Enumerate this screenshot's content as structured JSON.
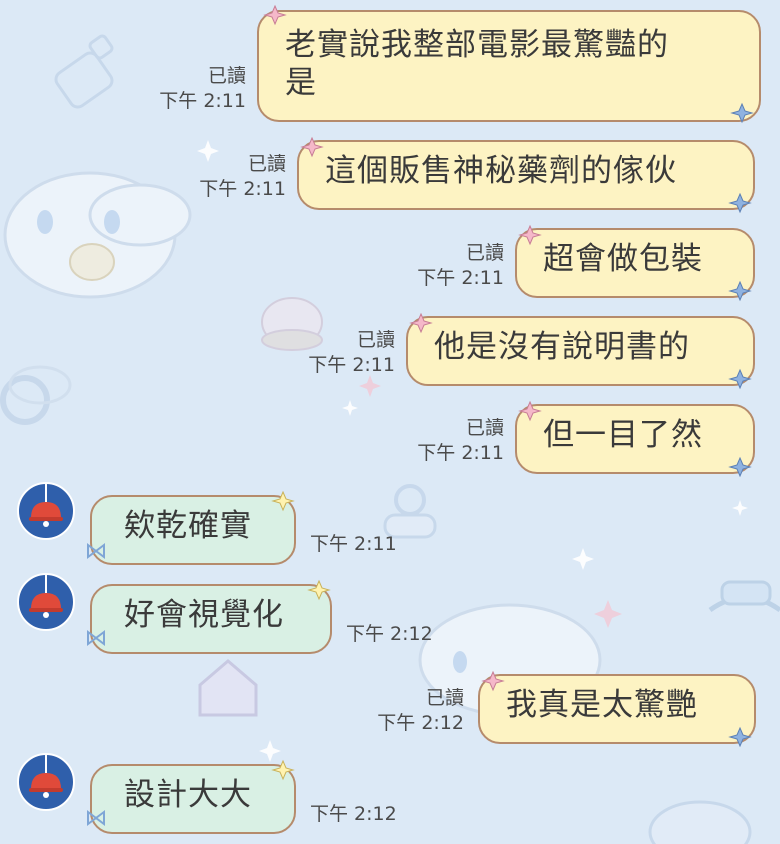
{
  "colors": {
    "background": "#dce9f6",
    "outgoing_bubble": "#fdf3c3",
    "incoming_bubble": "#d9f0e4",
    "bubble_border": "#b58b6c",
    "avatar_blue": "#2f5fab",
    "lamp_red": "#e04a3a"
  },
  "messages": [
    {
      "side": "out",
      "text_line1": "老實說我整部電影最驚豔的",
      "text_line2": "是",
      "read": "已讀",
      "time": "下午 2:11"
    },
    {
      "side": "out",
      "text": "這個販售神秘藥劑的傢伙",
      "read": "已讀",
      "time": "下午 2:11"
    },
    {
      "side": "out",
      "text": "超會做包裝",
      "read": "已讀",
      "time": "下午 2:11"
    },
    {
      "side": "out",
      "text": "他是沒有說明書的",
      "read": "已讀",
      "time": "下午 2:11"
    },
    {
      "side": "out",
      "text": "但一目了然",
      "read": "已讀",
      "time": "下午 2:11"
    },
    {
      "side": "in",
      "text": "欸乾確實",
      "time": "下午 2:11",
      "avatar_icon": "lamp-icon"
    },
    {
      "side": "in",
      "text": "好會視覺化",
      "time": "下午 2:12",
      "avatar_icon": "lamp-icon"
    },
    {
      "side": "out",
      "text": "我真是太驚艷",
      "read": "已讀",
      "time": "下午 2:12"
    },
    {
      "side": "in",
      "text": "設計大大",
      "time": "下午 2:12",
      "avatar_icon": "lamp-icon"
    }
  ]
}
